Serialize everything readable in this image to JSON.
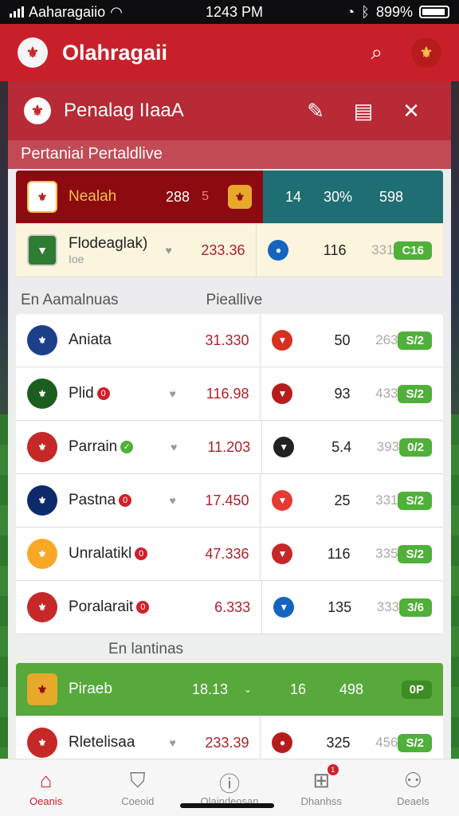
{
  "status_bar": {
    "carrier": "Aaharagaiio",
    "time": "1243 PM",
    "battery": "899%"
  },
  "app_bar": {
    "title": "Olahragaii"
  },
  "panel": {
    "title": "Penalag IIaaA",
    "subtitle": "Pertaniai Pertaldlive"
  },
  "highlight_row": {
    "name": "Nealah",
    "score": "288",
    "mark": "5",
    "s1": "14",
    "s2": "30%",
    "s3": "598"
  },
  "cream_row": {
    "name": "Flodeaglak)",
    "sub": "Ioe",
    "score": "233.36",
    "s1": "116",
    "s2": "331",
    "pill": "C16"
  },
  "section1": {
    "left": "En Aamalnuas",
    "right": "Pieallive"
  },
  "rows": [
    {
      "name": "Aniata",
      "score": "31.330",
      "s1": "50",
      "s2": "263",
      "pill": "S/2",
      "crest_color": "#1c3f8a",
      "badge_color": "#d6311f",
      "dot": "",
      "chev": ""
    },
    {
      "name": "Plid",
      "score": "116.98",
      "s1": "93",
      "s2": "433",
      "pill": "S/2",
      "crest_color": "#1b5e20",
      "badge_color": "#b71c1c",
      "dot": "0",
      "chev": "♥"
    },
    {
      "name": "Parrain",
      "score": "11.203",
      "s1": "5.4",
      "s2": "393",
      "pill": "0/2",
      "crest_color": "#c62828",
      "badge_color": "#222",
      "dot": "✓",
      "chev": "♥"
    },
    {
      "name": "Pastna",
      "score": "17.450",
      "s1": "25",
      "s2": "331",
      "pill": "S/2",
      "crest_color": "#0d2a6b",
      "badge_color": "#e53935",
      "dot": "0",
      "chev": "♥"
    },
    {
      "name": "Unralatikl",
      "score": "47.336",
      "s1": "116",
      "s2": "335",
      "pill": "S/2",
      "crest_color": "#f9a825",
      "badge_color": "#c62828",
      "dot": "0",
      "chev": ""
    },
    {
      "name": "Poralarait",
      "score": "6.333",
      "s1": "135",
      "s2": "333",
      "pill": "3/6",
      "crest_color": "#c62828",
      "badge_color": "#1565c0",
      "dot": "0",
      "chev": ""
    }
  ],
  "section2": {
    "left": "En lantinas"
  },
  "green_row": {
    "name": "Piraeb",
    "score": "18.13",
    "s1": "16",
    "s2": "498",
    "pill": "0P"
  },
  "last_row": {
    "name": "Rletelisaa",
    "score": "233.39",
    "s1": "325",
    "s2": "456",
    "pill": "S/2"
  },
  "nav": [
    {
      "label": "Oeanis",
      "icon": "home-icon"
    },
    {
      "label": "Coeoid",
      "icon": "shield-icon"
    },
    {
      "label": "Olaindeosan",
      "icon": "alert-icon"
    },
    {
      "label": "Dhanhss",
      "icon": "plus-box-icon",
      "badge": "1"
    },
    {
      "label": "Deaels",
      "icon": "user-icon"
    }
  ],
  "colors": {
    "brand_red": "#c8202a",
    "accent_green": "#4fb03a",
    "teal": "#1f6e73"
  }
}
